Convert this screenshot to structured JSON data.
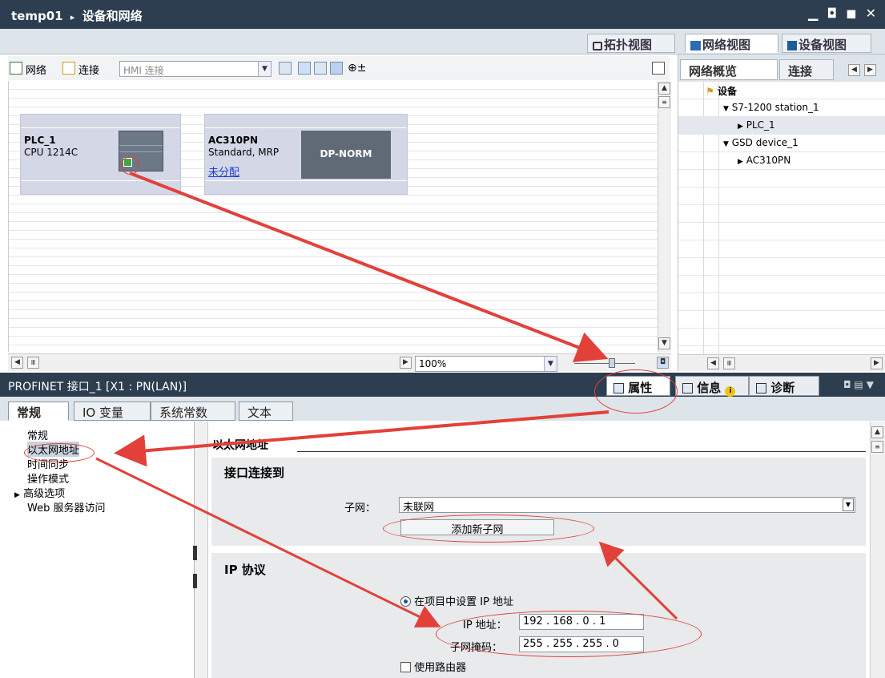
{
  "titlebar": {
    "project": "temp01",
    "separator": "▸",
    "title": "设备和网络",
    "controls": "▁ ◘ ◼ ✕"
  },
  "view_tabs": [
    {
      "label": "拓扑视图"
    },
    {
      "label": "网络视图"
    },
    {
      "label": "设备视图"
    }
  ],
  "toolbar": {
    "network_label": "网络",
    "connect_label": "连接",
    "connection_type": "HMI 连接"
  },
  "devices": [
    {
      "name": "PLC_1",
      "type": "CPU 1214C"
    },
    {
      "name": "AC310PN",
      "type": "Standard, MRP",
      "assign_link": "未分配",
      "module_label": "DP-NORM"
    }
  ],
  "zoom": {
    "value": "100%"
  },
  "overview": {
    "tabs": [
      "网络概览",
      "连接"
    ],
    "header": "设备",
    "tree": [
      {
        "label": "S7-1200 station_1",
        "expander": "▼",
        "level": 1
      },
      {
        "label": "PLC_1",
        "expander": "▶",
        "level": 2
      },
      {
        "label": "GSD device_1",
        "expander": "▼",
        "level": 1
      },
      {
        "label": "AC310PN",
        "expander": "▶",
        "level": 2
      }
    ]
  },
  "properties": {
    "title": "PROFINET 接口_1 [X1 : PN(LAN)]",
    "tabs": [
      {
        "label": "属性"
      },
      {
        "label": "信息"
      },
      {
        "label": "诊断"
      }
    ],
    "subtabs": [
      "常规",
      "IO 变量",
      "系统常数",
      "文本"
    ]
  },
  "nav": {
    "items": [
      "常规",
      "以太网地址",
      "时间同步",
      "操作模式",
      "高级选项",
      "Web 服务器访问"
    ],
    "expander": "▶"
  },
  "ethernet": {
    "heading": "以太网地址",
    "interface_section": "接口连接到",
    "subnet_label": "子网：",
    "subnet_value": "未联网",
    "add_subnet_button": "添加新子网",
    "ip_section": "IP 协议",
    "set_ip_option": "在项目中设置 IP 地址",
    "ip_label": "IP 地址：",
    "ip_value": "192 . 168 . 0   . 1",
    "mask_label": "子网掩码：",
    "mask_value": "255 . 255 . 255 . 0",
    "router_label": "使用路由器"
  },
  "colors": {
    "titlebar": "#2c3e50",
    "annotation": "#e2413a",
    "device_box": "#d4d8e6"
  }
}
